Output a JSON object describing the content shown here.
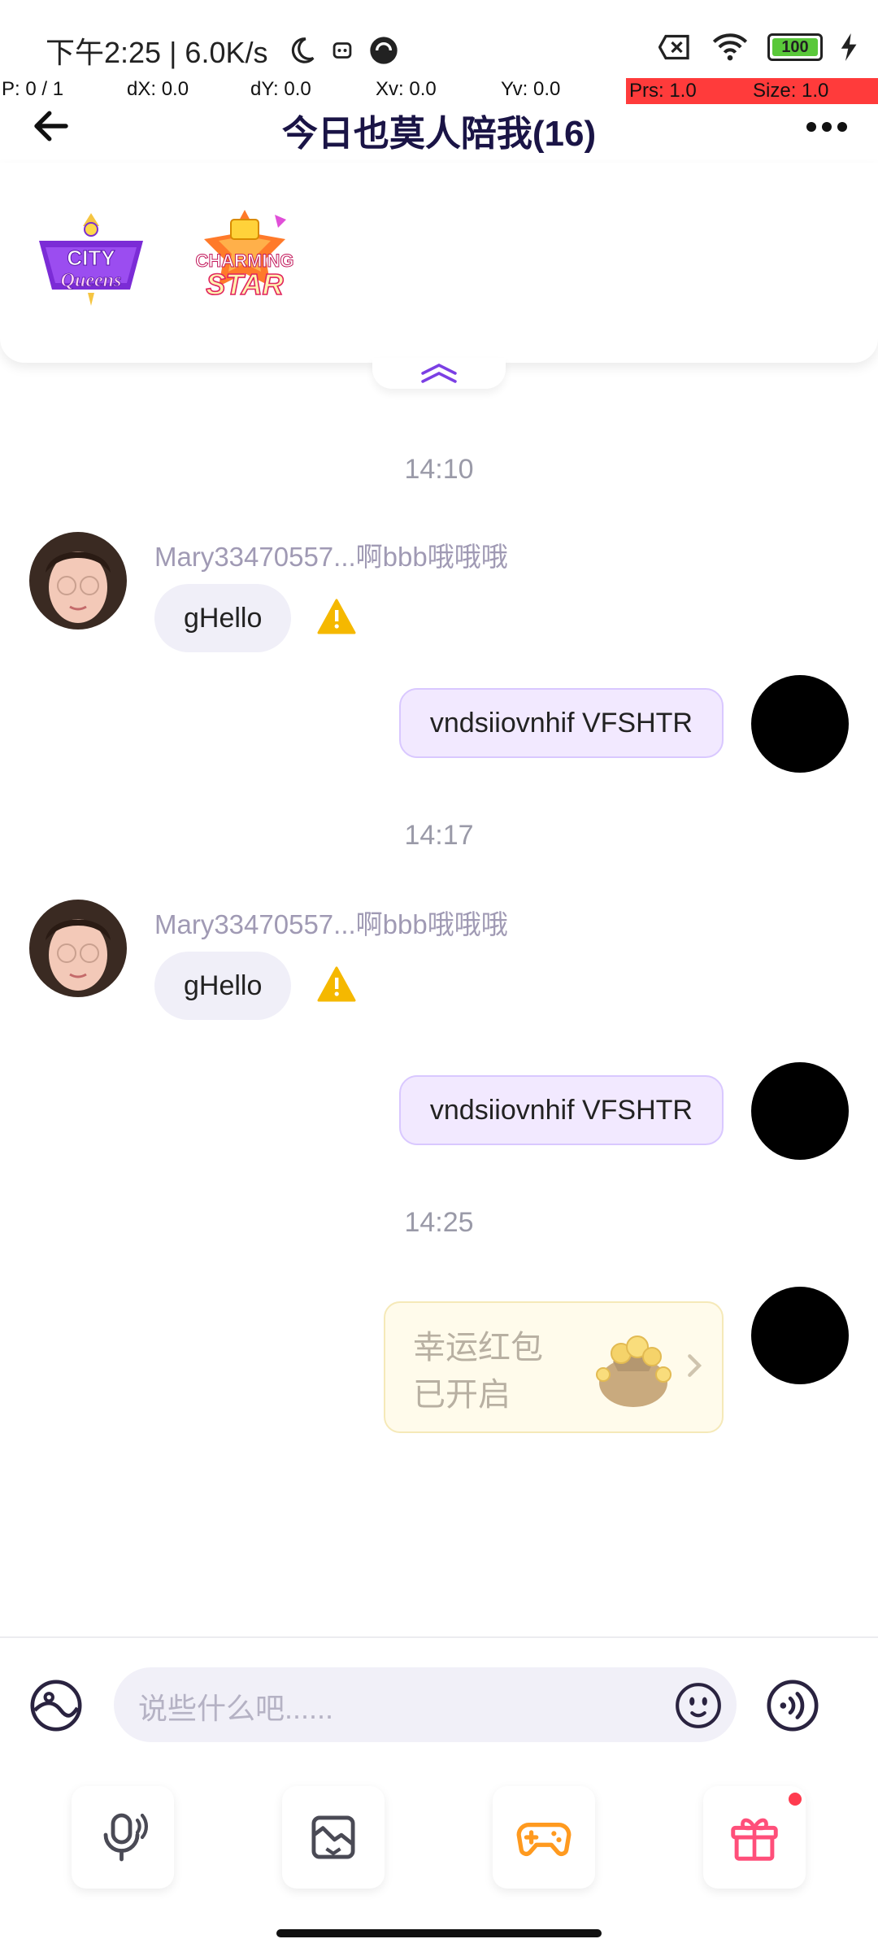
{
  "status_bar": {
    "time_speed": "下午2:25 | 6.0K/s",
    "battery": "100"
  },
  "debug_overlay": {
    "p": "P: 0 / 1",
    "dx": "dX: 0.0",
    "dy": "dY: 0.0",
    "xv": "Xv: 0.0",
    "yv": "Yv: 0.0",
    "prs": "Prs: 1.0",
    "size": "Size: 1.0"
  },
  "header": {
    "title": "今日也莫人陪我(16)"
  },
  "badges": [
    "CITY Queens",
    "CHARMING STAR"
  ],
  "messages": [
    {
      "time": "14:10",
      "sender": "Mary33470557...啊bbb哦哦哦",
      "incoming_text": "gHello",
      "outgoing_text": "vndsiiovnhif VFSHTR"
    },
    {
      "time": "14:17",
      "sender": "Mary33470557...啊bbb哦哦哦",
      "incoming_text": "gHello",
      "outgoing_text": "vndsiiovnhif VFSHTR"
    },
    {
      "time": "14:25",
      "red_packet_line1": "幸运红包",
      "red_packet_line2": "已开启"
    }
  ],
  "input": {
    "placeholder": "说些什么吧......"
  },
  "colors": {
    "accent": "#7b3fe4",
    "bubble_out": "#f2e9ff",
    "bubble_in": "#f0eff8",
    "warning": "#f5b800",
    "gift": "#ff4f7a",
    "game": "#ff9a1f"
  }
}
